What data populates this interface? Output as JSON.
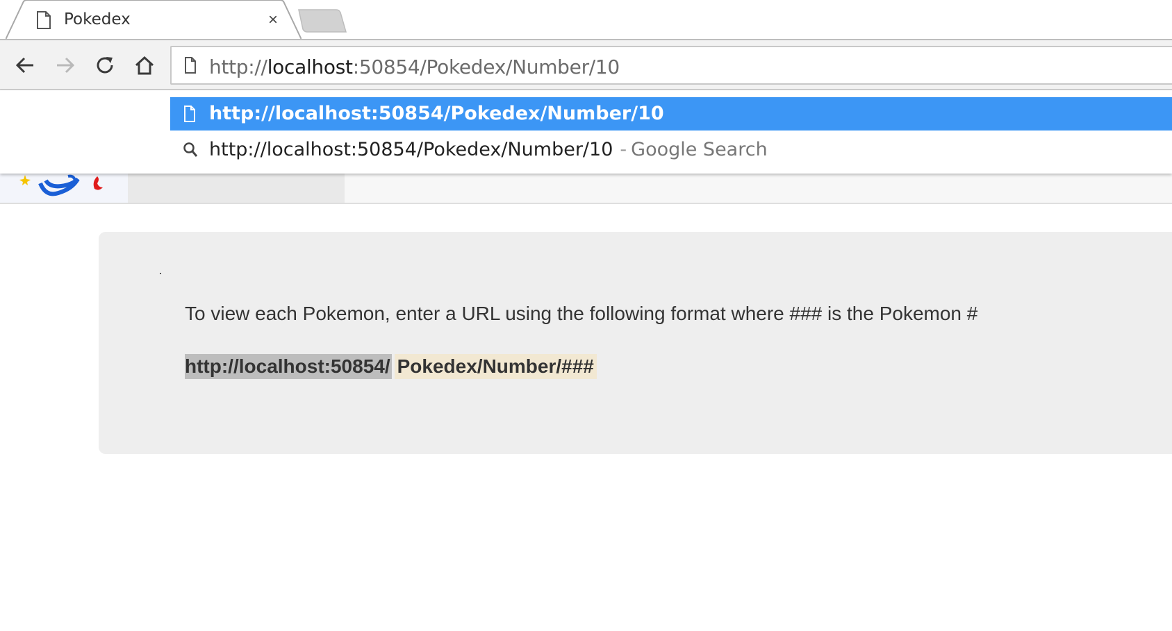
{
  "browser": {
    "tab": {
      "title": "Pokedex",
      "close_glyph": "×"
    },
    "toolbar": {
      "back_icon": "arrow-left-icon",
      "forward_icon": "arrow-right-icon",
      "reload_icon": "reload-icon",
      "home_icon": "home-icon"
    },
    "omnibox": {
      "scheme": "http://",
      "host": "localhost",
      "rest": ":50854/Pokedex/Number/10"
    },
    "suggestions": [
      {
        "icon": "page-icon",
        "text": "http://localhost:50854/Pokedex/Number/10"
      },
      {
        "icon": "search-icon",
        "text": "http://localhost:50854/Pokedex/Number/10",
        "separator": "-",
        "hint": "Google Search"
      }
    ]
  },
  "page": {
    "intro_text": "To view each Pokemon, enter a URL using the following format where ### is the Pokemon #",
    "url_base": "http://localhost:50854/",
    "url_path": "Pokedex/Number/###"
  },
  "colors": {
    "selected_suggestion": "#3c96f5",
    "jumbotron_bg": "#eeeeee"
  }
}
